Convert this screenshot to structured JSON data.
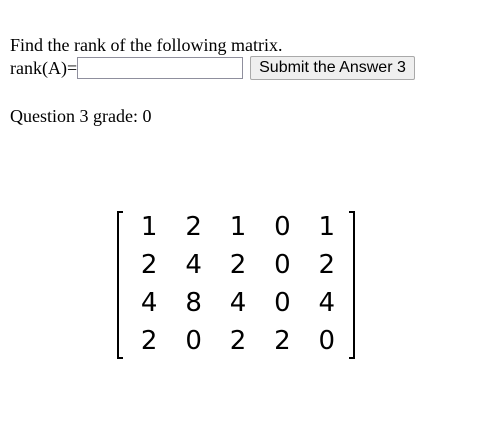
{
  "question": {
    "prompt": "Find the rank of the following matrix.",
    "answer_label": "rank(A)=",
    "answer_value": "",
    "submit_label": "Submit the Answer 3",
    "grade_label": "Question 3 grade:",
    "grade_value": "0"
  },
  "matrix": {
    "rows": [
      [
        "1",
        "2",
        "1",
        "0",
        "1"
      ],
      [
        "2",
        "4",
        "2",
        "0",
        "2"
      ],
      [
        "4",
        "8",
        "4",
        "0",
        "4"
      ],
      [
        "2",
        "0",
        "2",
        "2",
        "0"
      ]
    ]
  }
}
